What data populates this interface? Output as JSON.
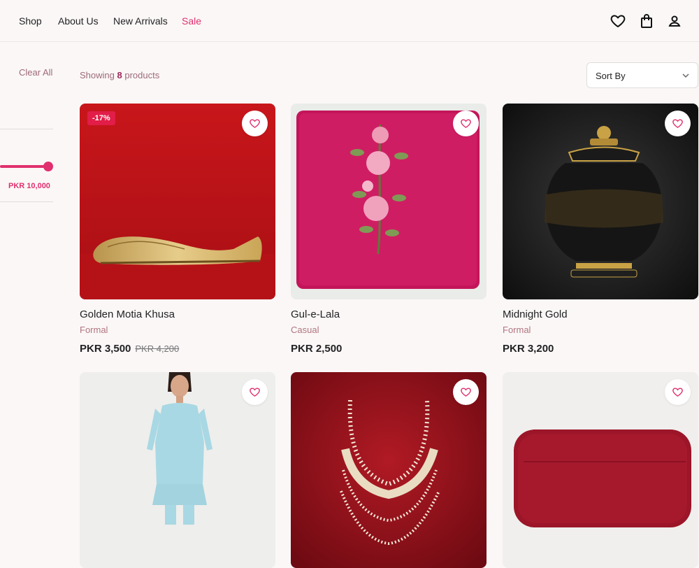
{
  "nav": {
    "links": [
      {
        "label": "Shop"
      },
      {
        "label": "About Us"
      },
      {
        "label": "New Arrivals"
      },
      {
        "label": "Sale"
      }
    ],
    "icons": [
      "heart-icon",
      "bag-icon",
      "user-icon"
    ]
  },
  "filters": {
    "clear_all": "Clear All",
    "price_max": "PKR 10,000",
    "slider_level_percent": 100
  },
  "results": {
    "prefix": "Showing",
    "count": "8",
    "suffix": "products"
  },
  "sort": {
    "label": "Sort By"
  },
  "colors": {
    "accent": "#e0306e",
    "badge": "#e11d48",
    "category": "#b0757f"
  },
  "products": [
    {
      "name": "Golden Motia Khusa",
      "category": "Formal",
      "price": "PKR 3,500",
      "old_price": "PKR 4,200",
      "badge": "-17%"
    },
    {
      "name": "Gul-e-Lala",
      "category": "Casual",
      "price": "PKR 2,500"
    },
    {
      "name": "Midnight Gold",
      "category": "Formal",
      "price": "PKR 3,200"
    },
    {
      "name": "",
      "category": "",
      "price": ""
    },
    {
      "name": "",
      "category": "",
      "price": ""
    },
    {
      "name": "",
      "category": "",
      "price": ""
    }
  ]
}
